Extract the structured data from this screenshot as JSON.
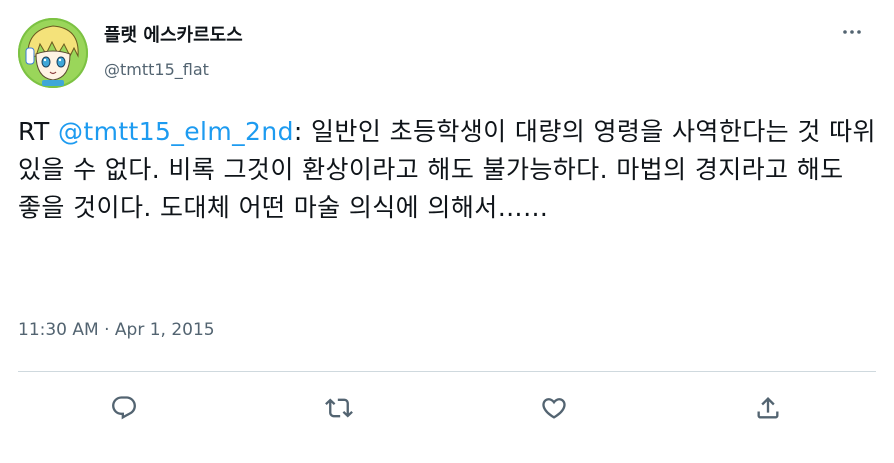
{
  "user": {
    "display_name": "플랫 에스카르도스",
    "handle": "@tmtt15_flat",
    "avatar_icon": "anime-avatar"
  },
  "tweet": {
    "prefix": "RT ",
    "mention": "@tmtt15_elm_2nd",
    "text": ": 일반인 초등학생이 대량의 영령을 사역한다는 것 따위 있을 수 없다. 비록 그것이 환상이라고 해도 불가능하다. 마법의 경지라고 해도 좋을 것이다. 도대체 어떤 마술 의식에 의해서……",
    "time": "11:30 AM",
    "separator": " · ",
    "date": "Apr 1, 2015"
  },
  "actions": {
    "reply_icon": "reply-icon",
    "retweet_icon": "retweet-icon",
    "like_icon": "heart-icon",
    "share_icon": "share-icon",
    "more_icon": "more-horizontal-icon"
  },
  "colors": {
    "link": "#1d9bf0",
    "secondary": "#536471",
    "text": "#0f1419",
    "divider": "#cfd9de"
  }
}
